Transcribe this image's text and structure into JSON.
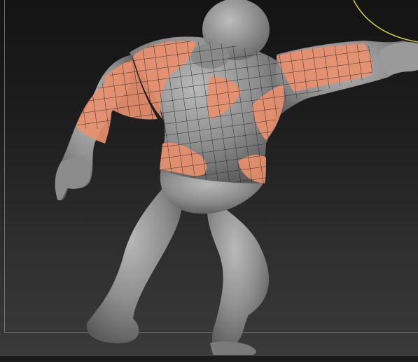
{
  "viewport": {
    "background_top": "#141414",
    "background_bottom": "#3b3b3b"
  },
  "model": {
    "skin_color": "#8f8f8f",
    "skin_highlight": "#b8b8b8",
    "polygroup_color": "#e8906e",
    "wire_color": "#1e1e1e"
  },
  "gizmo": {
    "ring_color": "#d8d23a"
  },
  "bounding_frame": {
    "color": "#8a8a8a"
  }
}
